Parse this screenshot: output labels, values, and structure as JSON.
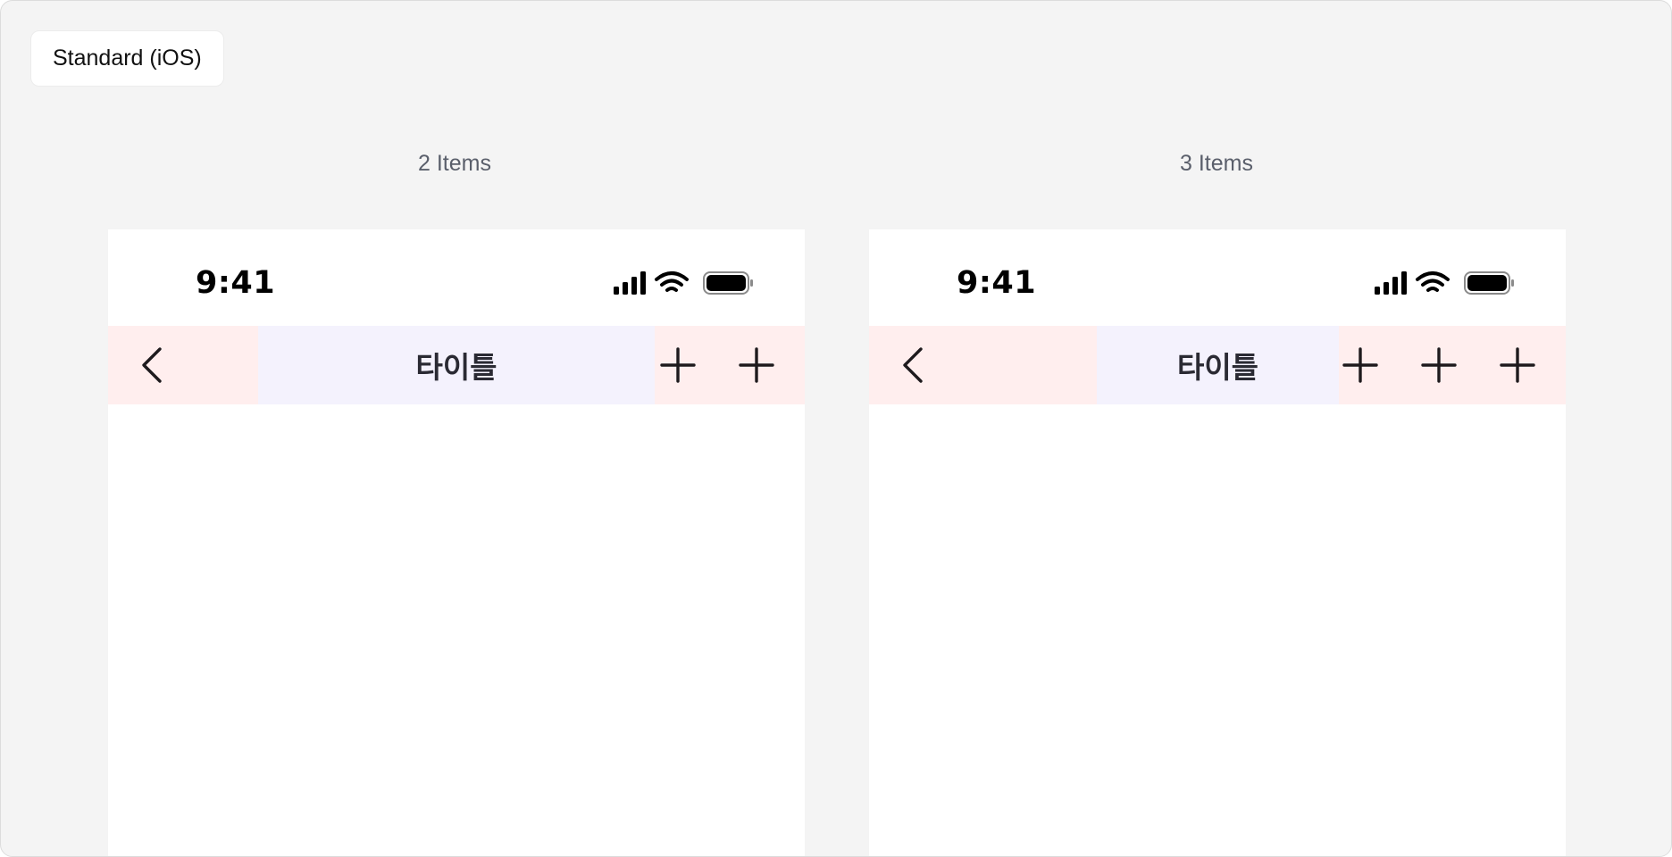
{
  "section": {
    "label": "Standard (iOS)"
  },
  "variants": [
    {
      "label": "2 Items",
      "status": {
        "time": "9:41",
        "icons": [
          "cellular-signal-icon",
          "wifi-icon",
          "battery-icon"
        ]
      },
      "navbar": {
        "leading_icon": "chevron-left-icon",
        "title": "타이틀",
        "trailing_icons": [
          "plus-icon",
          "plus-icon"
        ]
      }
    },
    {
      "label": "3 Items",
      "status": {
        "time": "9:41",
        "icons": [
          "cellular-signal-icon",
          "wifi-icon",
          "battery-icon"
        ]
      },
      "navbar": {
        "leading_icon": "chevron-left-icon",
        "title": "타이틀",
        "trailing_icons": [
          "plus-icon",
          "plus-icon",
          "plus-icon"
        ]
      }
    }
  ],
  "colors": {
    "canvas": "#f4f4f4",
    "slot_highlight": "#ffeeee",
    "title_highlight": "#f4f2fd",
    "icon": "#1e1a1d",
    "label_text": "#5a5f6b"
  }
}
